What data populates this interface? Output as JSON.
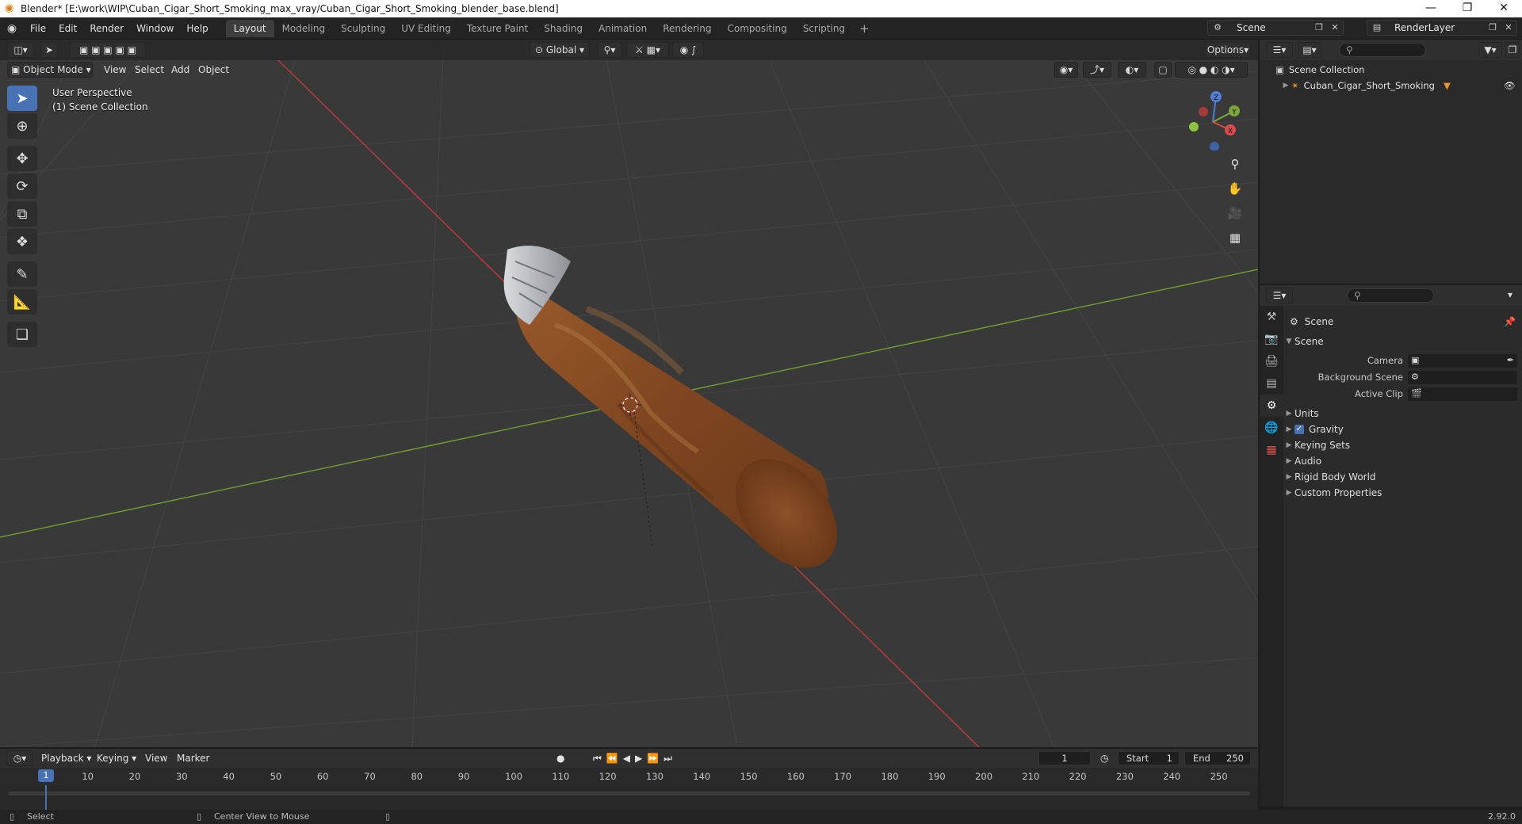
{
  "window": {
    "title": "Blender* [E:\\work\\WIP\\Cuban_Cigar_Short_Smoking_max_vray/Cuban_Cigar_Short_Smoking_blender_base.blend]",
    "controls": [
      "—",
      "❐",
      "✕"
    ]
  },
  "menu": {
    "items": [
      "File",
      "Edit",
      "Render",
      "Window",
      "Help"
    ]
  },
  "workspaces": {
    "tabs": [
      "Layout",
      "Modeling",
      "Sculpting",
      "UV Editing",
      "Texture Paint",
      "Shading",
      "Animation",
      "Rendering",
      "Compositing",
      "Scripting"
    ],
    "active": "Layout",
    "add": "+"
  },
  "scene_selector": {
    "value": "Scene"
  },
  "render_layer_selector": {
    "value": "RenderLayer"
  },
  "viewport": {
    "orientation": "Global",
    "options_label": "Options",
    "mode": "Object Mode",
    "menu": [
      "View",
      "Select",
      "Add",
      "Object"
    ],
    "overlay_line1": "User Perspective",
    "overlay_line2": "(1) Scene Collection",
    "gizmo_axes": {
      "z": "Z",
      "y": "Y",
      "x": "X"
    },
    "colors": {
      "background": "#393939",
      "x_axis": "#b83a3a",
      "y_axis": "#6e9a2e",
      "grid": "#444444",
      "cigar": "#8a4e27",
      "ash": "#bfc3c8"
    }
  },
  "tools": [
    "select-box",
    "cursor",
    "move",
    "rotate",
    "scale",
    "transform",
    "annotate",
    "measure",
    "add-cube"
  ],
  "outliner": {
    "root": "Scene Collection",
    "items": [
      {
        "label": "Cuban_Cigar_Short_Smoking"
      }
    ]
  },
  "properties": {
    "header": "Scene",
    "panel": "Scene",
    "fields": [
      {
        "label": "Camera"
      },
      {
        "label": "Background Scene"
      },
      {
        "label": "Active Clip"
      }
    ],
    "sections": [
      "Units",
      "Gravity",
      "Keying Sets",
      "Audio",
      "Rigid Body World",
      "Custom Properties"
    ],
    "gravity_checked": true
  },
  "timeline": {
    "menu": [
      "Playback",
      "Keying",
      "View",
      "Marker"
    ],
    "current_frame": "1",
    "start_label": "Start",
    "start": "1",
    "end_label": "End",
    "end": "250",
    "ruler": [
      "1",
      "10",
      "20",
      "30",
      "40",
      "50",
      "60",
      "70",
      "80",
      "90",
      "100",
      "110",
      "120",
      "130",
      "140",
      "150",
      "160",
      "170",
      "180",
      "190",
      "200",
      "210",
      "220",
      "230",
      "240",
      "250"
    ]
  },
  "status": {
    "left": "Select",
    "middle": "Center View to Mouse",
    "version": "2.92.0"
  }
}
